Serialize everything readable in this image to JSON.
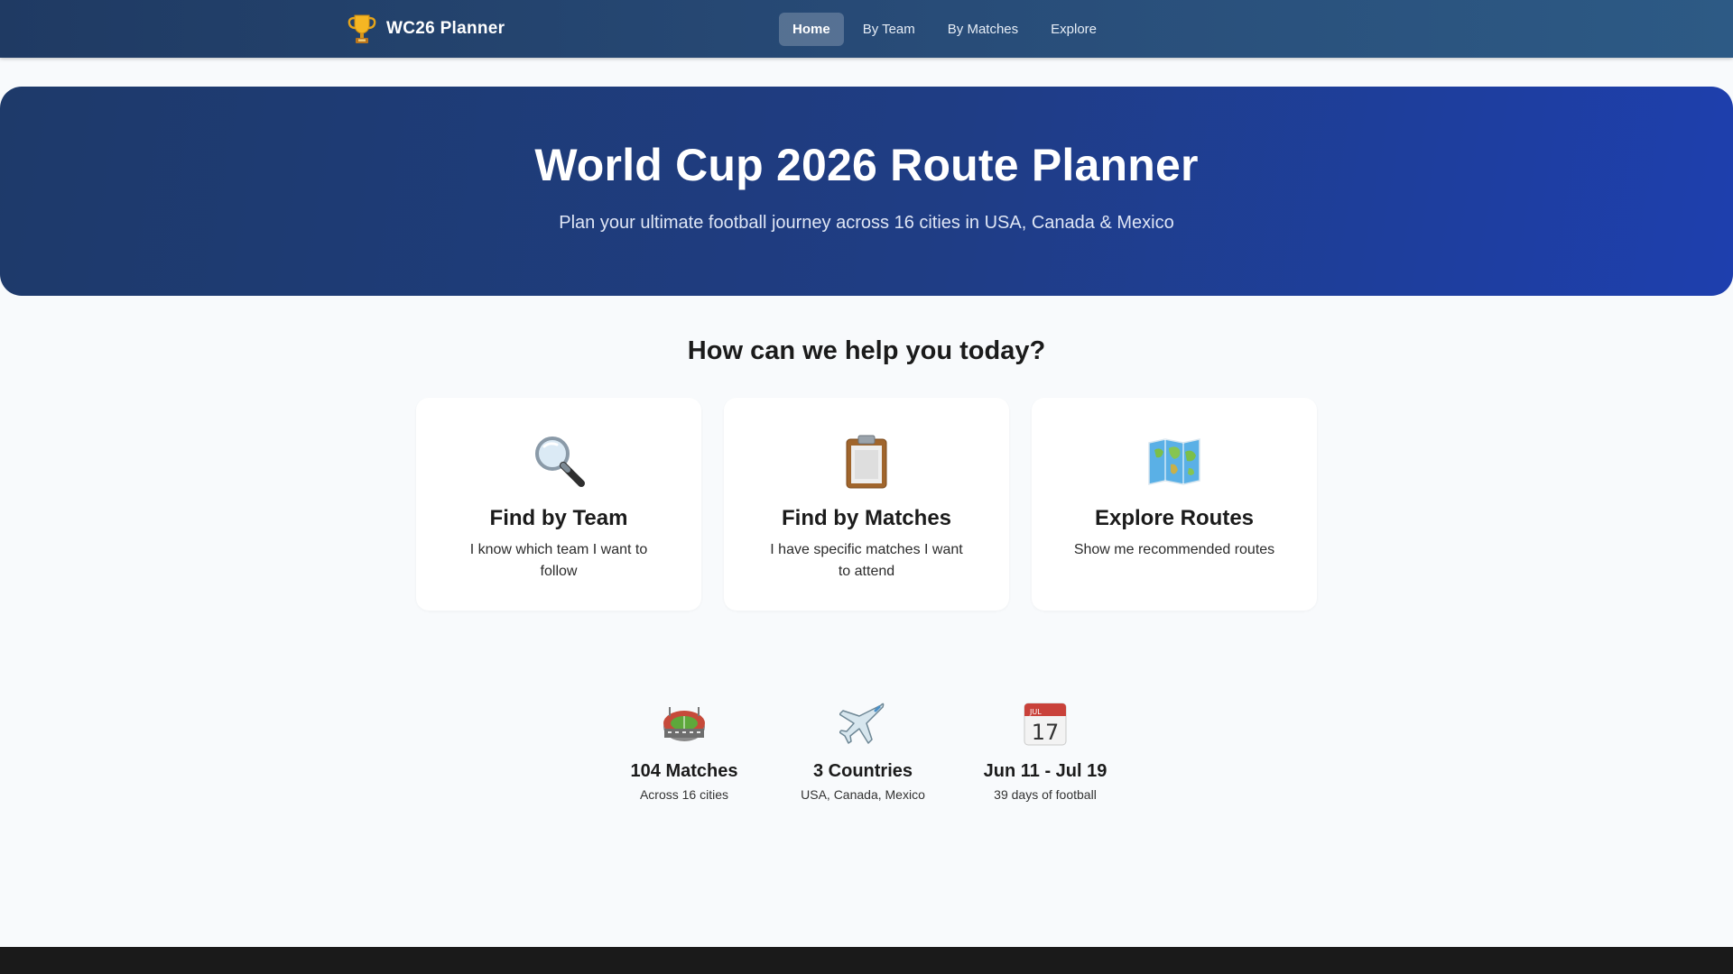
{
  "navbar": {
    "brand": "WC26 Planner",
    "brand_icon": "trophy-icon",
    "items": [
      {
        "label": "Home",
        "active": true
      },
      {
        "label": "By Team",
        "active": false
      },
      {
        "label": "By Matches",
        "active": false
      },
      {
        "label": "Explore",
        "active": false
      }
    ]
  },
  "hero": {
    "title": "World Cup 2026 Route Planner",
    "subtitle": "Plan your ultimate football journey across 16 cities in USA, Canada & Mexico"
  },
  "help": {
    "title": "How can we help you today?",
    "cards": [
      {
        "icon": "magnifying-glass-icon",
        "title": "Find by Team",
        "description": "I know which team I want to follow"
      },
      {
        "icon": "clipboard-icon",
        "title": "Find by Matches",
        "description": "I have specific matches I want to attend"
      },
      {
        "icon": "world-map-icon",
        "title": "Explore Routes",
        "description": "Show me recommended routes"
      }
    ]
  },
  "stats": [
    {
      "icon": "stadium-icon",
      "value": "104 Matches",
      "label": "Across 16 cities"
    },
    {
      "icon": "airplane-icon",
      "value": "3 Countries",
      "label": "USA, Canada, Mexico"
    },
    {
      "icon": "calendar-icon",
      "value": "Jun 11 - Jul 19",
      "label": "39 days of football"
    }
  ],
  "calendar_icon": {
    "month": "JUL",
    "day": "17"
  },
  "colors": {
    "navbar": "#284c78",
    "hero_start": "#1e3a6a",
    "hero_end": "#1e3fae",
    "background": "#f8fafc",
    "footer": "#1a1a1a"
  }
}
